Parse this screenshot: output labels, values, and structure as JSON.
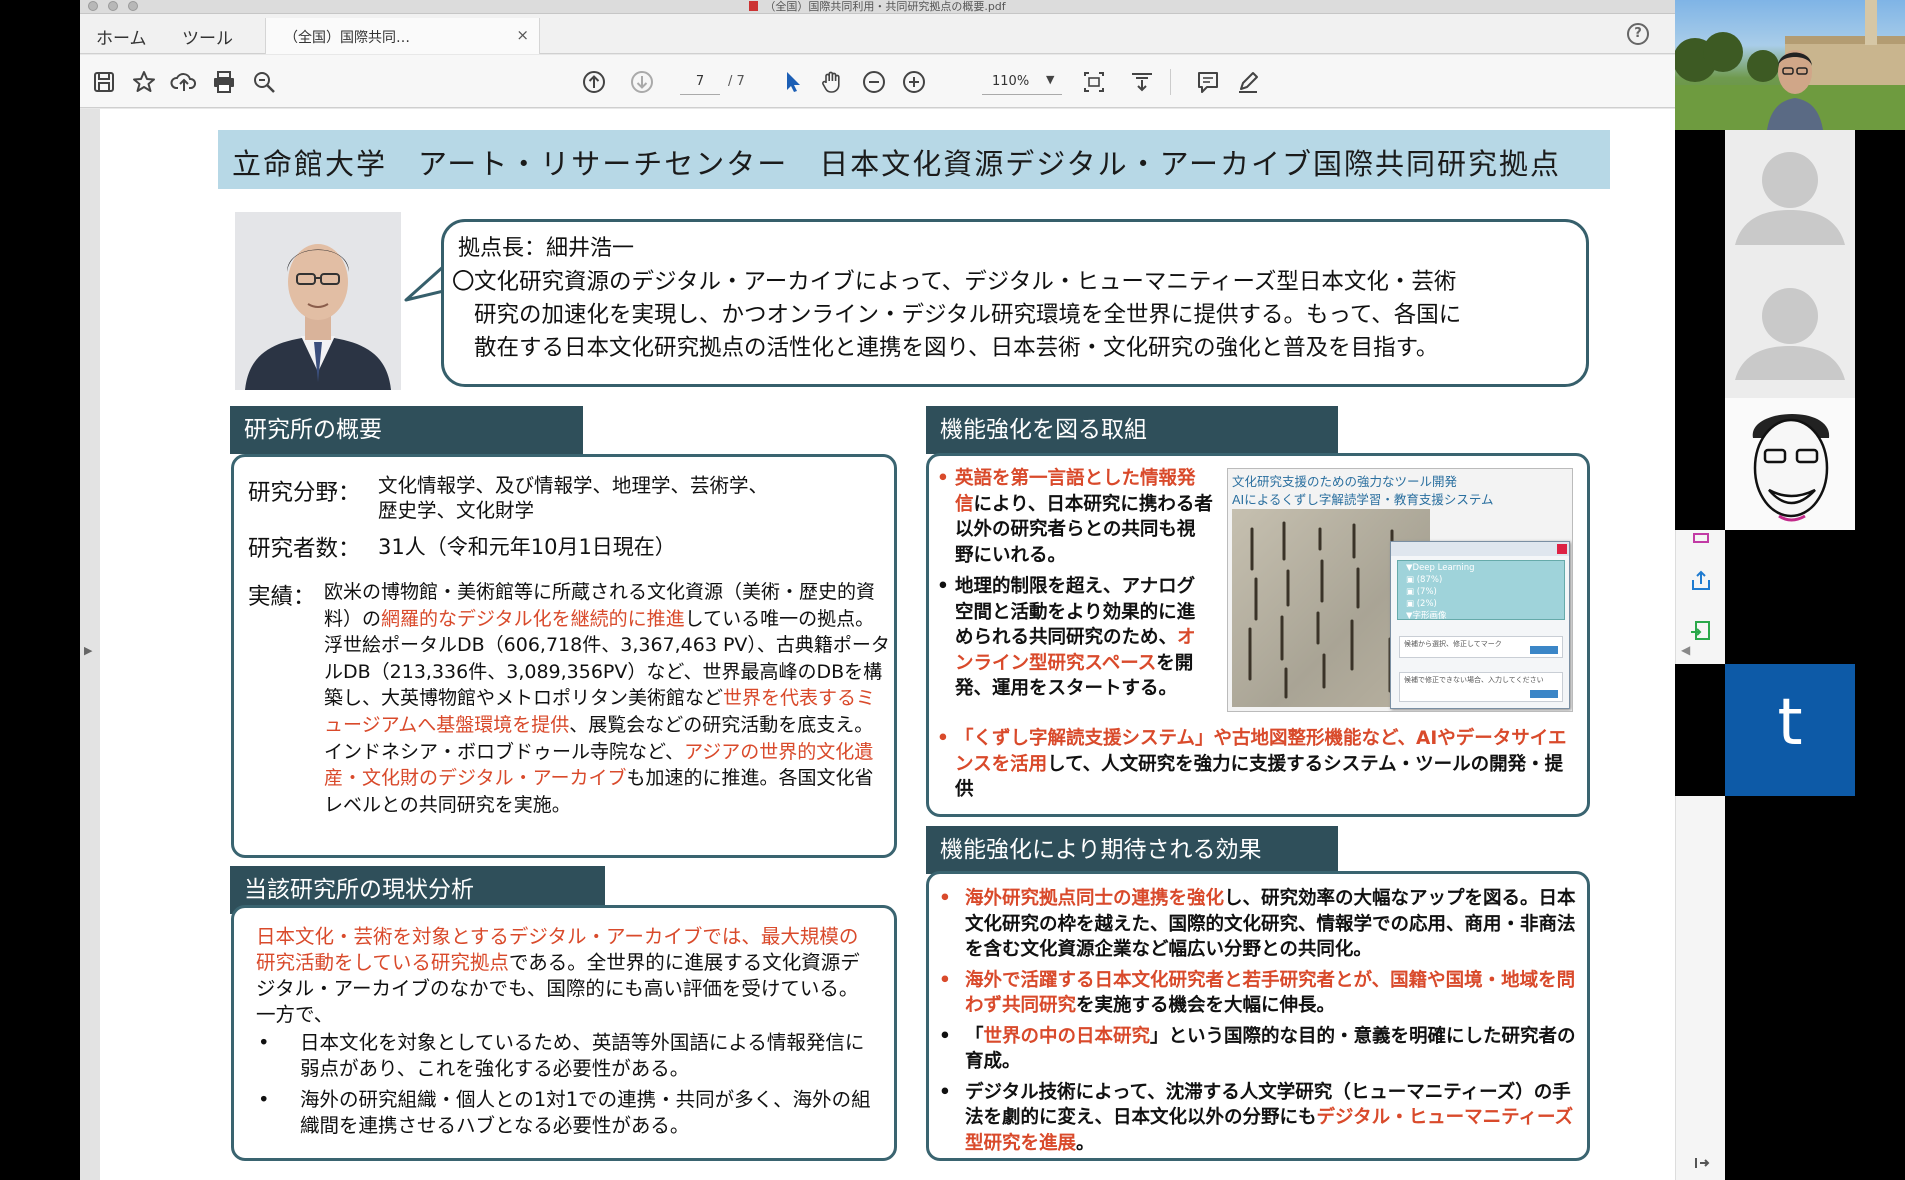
{
  "window": {
    "title": "（全国）国際共同利用・共同研究拠点の概要.pdf"
  },
  "tabs": {
    "home": "ホーム",
    "tools": "ツール",
    "document": "（全国）国際共同…",
    "close": "×"
  },
  "help_label": "?",
  "toolbar": {
    "page_current": "7",
    "page_total": "/ 7",
    "zoom": "110%"
  },
  "pdf": {
    "title": "立命館大学　アート・リサーチセンター　日本文化資源デジタル・アーカイブ国際共同研究拠点",
    "director_label": "拠点長：細井浩一",
    "director_statement": {
      "mark": "〇",
      "line1": "文化研究資源のデジタル・アーカイブによって、デジタル・ヒューマニティーズ型日本文化・芸術",
      "line2": "研究の加速化を実現し、かつオンライン・デジタル研究環境を全世界に提供する。もって、各国に",
      "line3": "散在する日本文化研究拠点の活性化と連携を図り、日本芸術・文化研究の強化と普及を目指す。"
    },
    "overview": {
      "header": "研究所の概要",
      "field_label": "研究分野：",
      "field_value_1": "文化情報学、及び情報学、地理学、芸術学、",
      "field_value_2": "歴史学、文化財学",
      "researchers_label": "研究者数：",
      "researchers_value": "31人（令和元年10月1日現在）",
      "results_label": "実績：",
      "results": {
        "a": "欧米の博物館・美術館等に所蔵される文化資源（美術・歴史的資料）の",
        "b_red": "網羅的なデジタル化を継続的に推進",
        "c": "している唯一の拠点。浮世絵ポータルDB（606,718件、3,367,463 PV）、古典籍ポータルDB（213,336件、3,089,356PV）など、世界最高峰のDBを構築し、大英博物館やメトロポリタン美術館など",
        "d_red": "世界を代表するミュージアムへ基盤環境を提供",
        "e": "、展覧会などの研究活動を底支え。インドネシア・ボロブドゥール寺院など、",
        "f_red": "アジアの世界的文化遺産・文化財のデジタル・アーカイブ",
        "g": "も加速的に推進。各国文化省レベルとの共同研究を実施。"
      }
    },
    "current": {
      "header": "当該研究所の現状分析",
      "intro_red": "日本文化・芸術を対象とするデジタル・アーカイブでは、最大規模の研究活動をしている研究拠点",
      "intro": "である。全世界的に進展する文化資源デジタル・アーカイブのなかでも、国際的にも高い評価を受けている。一方で、",
      "bullets": [
        "日本文化を対象としているため、英語等外国語による情報発信に弱点があり、これを強化する必要性がある。",
        "海外の研究組織・個人との1対1での連携・共同が多く、海外の組織間を連携させるハブとなる必要性がある。"
      ]
    },
    "strength": {
      "header": "機能強化を図る取組",
      "item1_red": "英語を第一言語とした情報発信",
      "item1": "により、日本研究に携わる者以外の研究者らとの共同も視野にいれる。",
      "item2a": "地理的制限を超え、アナログ空間と活動をより効果的に進められる共同研究のため、",
      "item2_red": "オンライン型研究スペース",
      "item2b": "を開発、運用をスタートする。",
      "item3_red": "「くずし字解読支援システム」や古地図整形機能など、AIやデータサイエンスを活用",
      "item3": "して、人文研究を強力に支援するシステム・ツールの開発・提供",
      "tool_image": {
        "title": "文化研究支援のための強力なツール開発",
        "subtitle": "AIによるくずし字解読学習・教育支援システム",
        "dialog_title": "",
        "panel_head": "▼Deep Learning",
        "panel_rows": [
          "▣ (87%)",
          "▣ (7%)",
          "▣ (2%)",
          "▼字形画像"
        ],
        "form1": "候補から選択、修正してマーク",
        "form2": "候補で修正できない場合、入力してください"
      }
    },
    "effect": {
      "header": "機能強化により期待される効果",
      "item1_red": "海外研究拠点同士の連携を強化",
      "item1": "し、研究効率の大幅なアップを図る。日本文化研究の枠を越えた、国際的文化研究、情報学での応用、商用・非商法を含む文化資源企業など幅広い分野との共同化。",
      "item2_red": "海外で活躍する日本文化研究者と若手研究者とが、国籍や国境・地域を問わず共同研究",
      "item2": "を実施する機会を大幅に伸長。",
      "item3a": "「",
      "item3_red": "世界の中の日本研究",
      "item3b": "」という国際的な目的・意義を明確にした研究者の育成。",
      "item4": "デジタル技術によって、沈滞する人文学研究（ヒューマニティーズ）の手法を劇的に変え、日本文化以外の分野にも",
      "item4_red": "デジタル・ヒューマニティーズ型研究を進展",
      "item4b": "。"
    }
  },
  "video": {
    "tile_t_letter": "t"
  },
  "colors": {
    "title_bar": "#b7d8e6",
    "section_header": "#2f4f5a",
    "box_border": "#3a6470",
    "emphasis_red": "#d94a2b",
    "zoom_tile_blue": "#0d5aa7"
  },
  "icons": [
    "save-icon",
    "bookmark-star-icon",
    "upload-cloud-icon",
    "print-icon",
    "zoom-search-icon",
    "page-up-icon",
    "page-down-icon",
    "select-arrow-icon",
    "hand-icon",
    "zoom-out-icon",
    "zoom-in-icon",
    "fit-page-icon",
    "scroll-mode-icon",
    "comment-icon",
    "pen-icon",
    "help-icon"
  ]
}
